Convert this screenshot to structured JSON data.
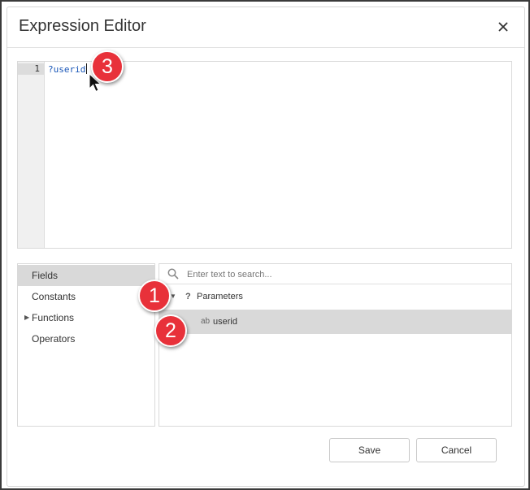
{
  "dialog": {
    "title": "Expression Editor",
    "close_icon": "close-icon"
  },
  "editor": {
    "line_number": "1",
    "code": "?userid"
  },
  "callouts": {
    "one": "1",
    "two": "2",
    "three": "3"
  },
  "categories": [
    {
      "label": "Fields",
      "selected": true
    },
    {
      "label": "Constants",
      "selected": false
    },
    {
      "label": "Functions",
      "selected": false,
      "expandable": true
    },
    {
      "label": "Operators",
      "selected": false
    }
  ],
  "search": {
    "placeholder": "Enter text to search...",
    "value": ""
  },
  "tree": {
    "group_label": "Parameters",
    "group_icon": "question-mark-icon",
    "items": [
      {
        "type_label": "ab",
        "label": "userid",
        "selected": true
      }
    ]
  },
  "footer": {
    "save_label": "Save",
    "cancel_label": "Cancel"
  },
  "colors": {
    "callout": "#e8313a",
    "code_text": "#1a57b8",
    "selection": "#d9d9d9"
  }
}
